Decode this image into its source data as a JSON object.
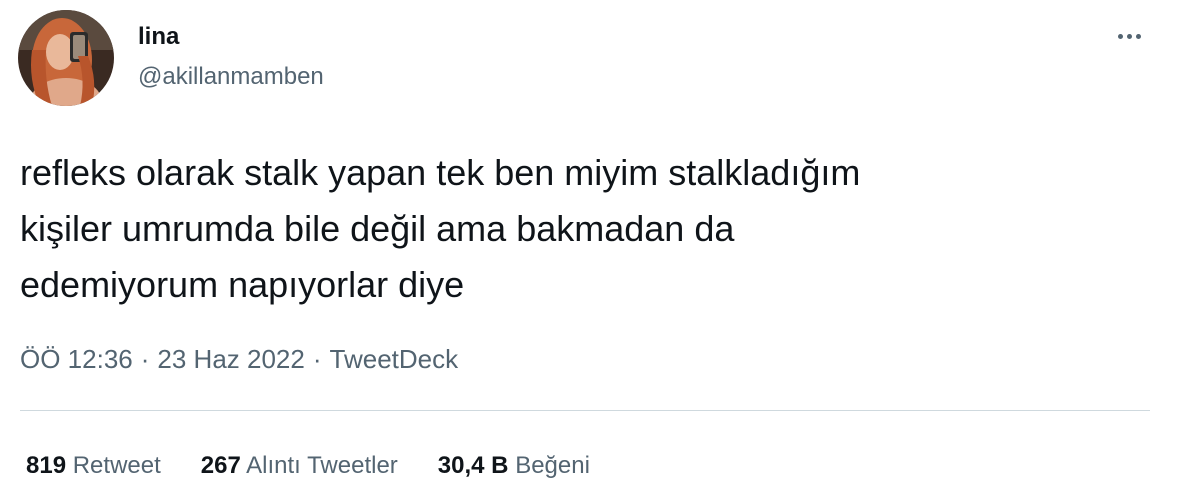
{
  "author": {
    "display_name": "lina",
    "handle": "@akillanmamben"
  },
  "tweet": {
    "text": "refleks olarak stalk yapan tek ben miyim stalkladığım\nkişiler umrumda bile değil ama bakmadan da\nedemiyorum napıyorlar diye",
    "time": "ÖÖ 12:36",
    "date": "23 Haz 2022",
    "source": "TweetDeck",
    "separator": "·"
  },
  "stats": [
    {
      "value": "819",
      "label": "Retweet"
    },
    {
      "value": "267",
      "label": "Alıntı Tweetler"
    },
    {
      "value": "30,4 B",
      "label": "Beğeni"
    }
  ],
  "icons": {
    "more": "more-horizontal-icon"
  },
  "colors": {
    "text_primary": "#0f1419",
    "text_secondary": "#536471",
    "divider": "#cfd9de"
  }
}
